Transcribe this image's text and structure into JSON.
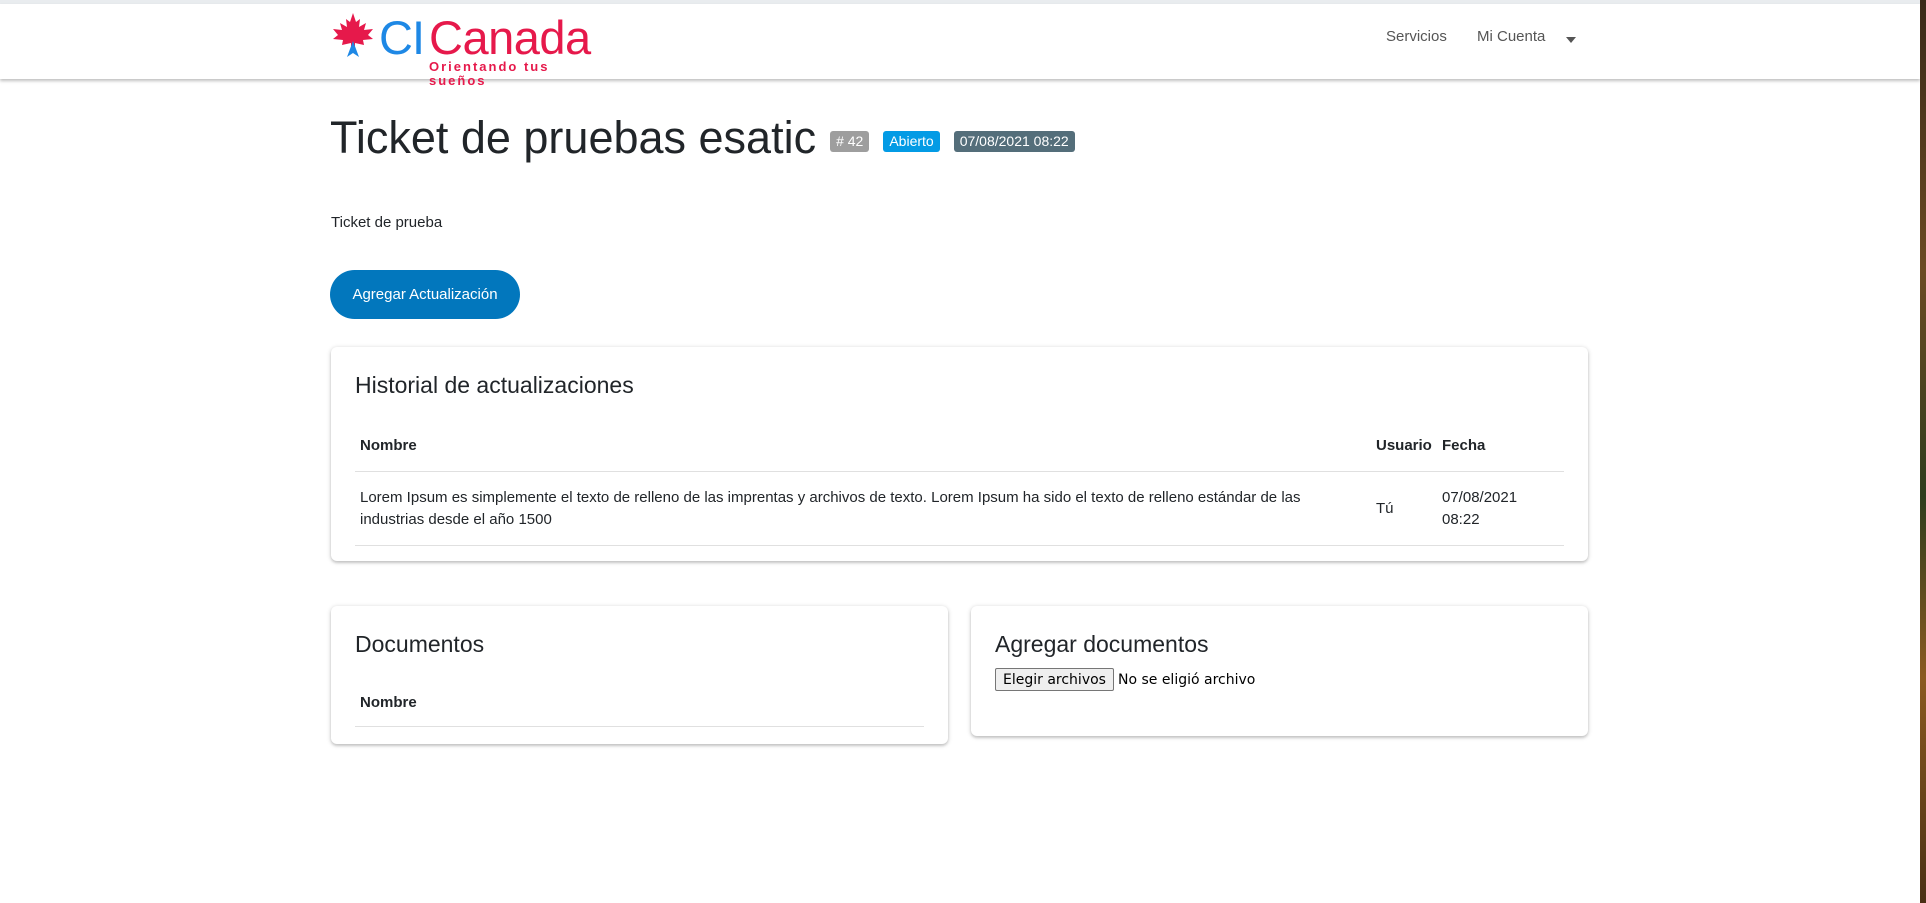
{
  "header": {
    "logo": {
      "brand_ci": "CI",
      "brand_name": "Canada",
      "tagline": "Orientando tus sueños",
      "leaf_icon": "maple-leaf-icon"
    },
    "nav": [
      {
        "label": "Servicios"
      },
      {
        "label": "Mi Cuenta"
      }
    ]
  },
  "ticket": {
    "title": "Ticket de pruebas esatic",
    "id_badge": "# 42",
    "status_badge": "Abierto",
    "date_badge": "07/08/2021 08:22",
    "description": "Ticket de prueba",
    "add_update_label": "Agregar Actualización"
  },
  "history": {
    "title": "Historial de actualizaciones",
    "columns": [
      "Nombre",
      "Usuario",
      "Fecha"
    ],
    "rows": [
      {
        "nombre": "Lorem Ipsum es simplemente el texto de relleno de las imprentas y archivos de texto. Lorem Ipsum ha sido el texto de relleno estándar de las industrias desde el año 1500",
        "usuario": "Tú",
        "fecha_date": "07/08/2021",
        "fecha_time": "08:22"
      }
    ]
  },
  "documents": {
    "title": "Documentos",
    "columns": [
      "Nombre"
    ]
  },
  "add_documents": {
    "title": "Agregar documentos",
    "choose_label": "Elegir archivos",
    "no_file_text": "No se eligió archivo"
  },
  "colors": {
    "primary_button": "#0277bd",
    "status_badge": "#039be5",
    "id_badge": "#9e9e9e",
    "date_badge": "#546e7a",
    "brand_red": "#e6194b",
    "brand_blue": "#1e88e5"
  }
}
